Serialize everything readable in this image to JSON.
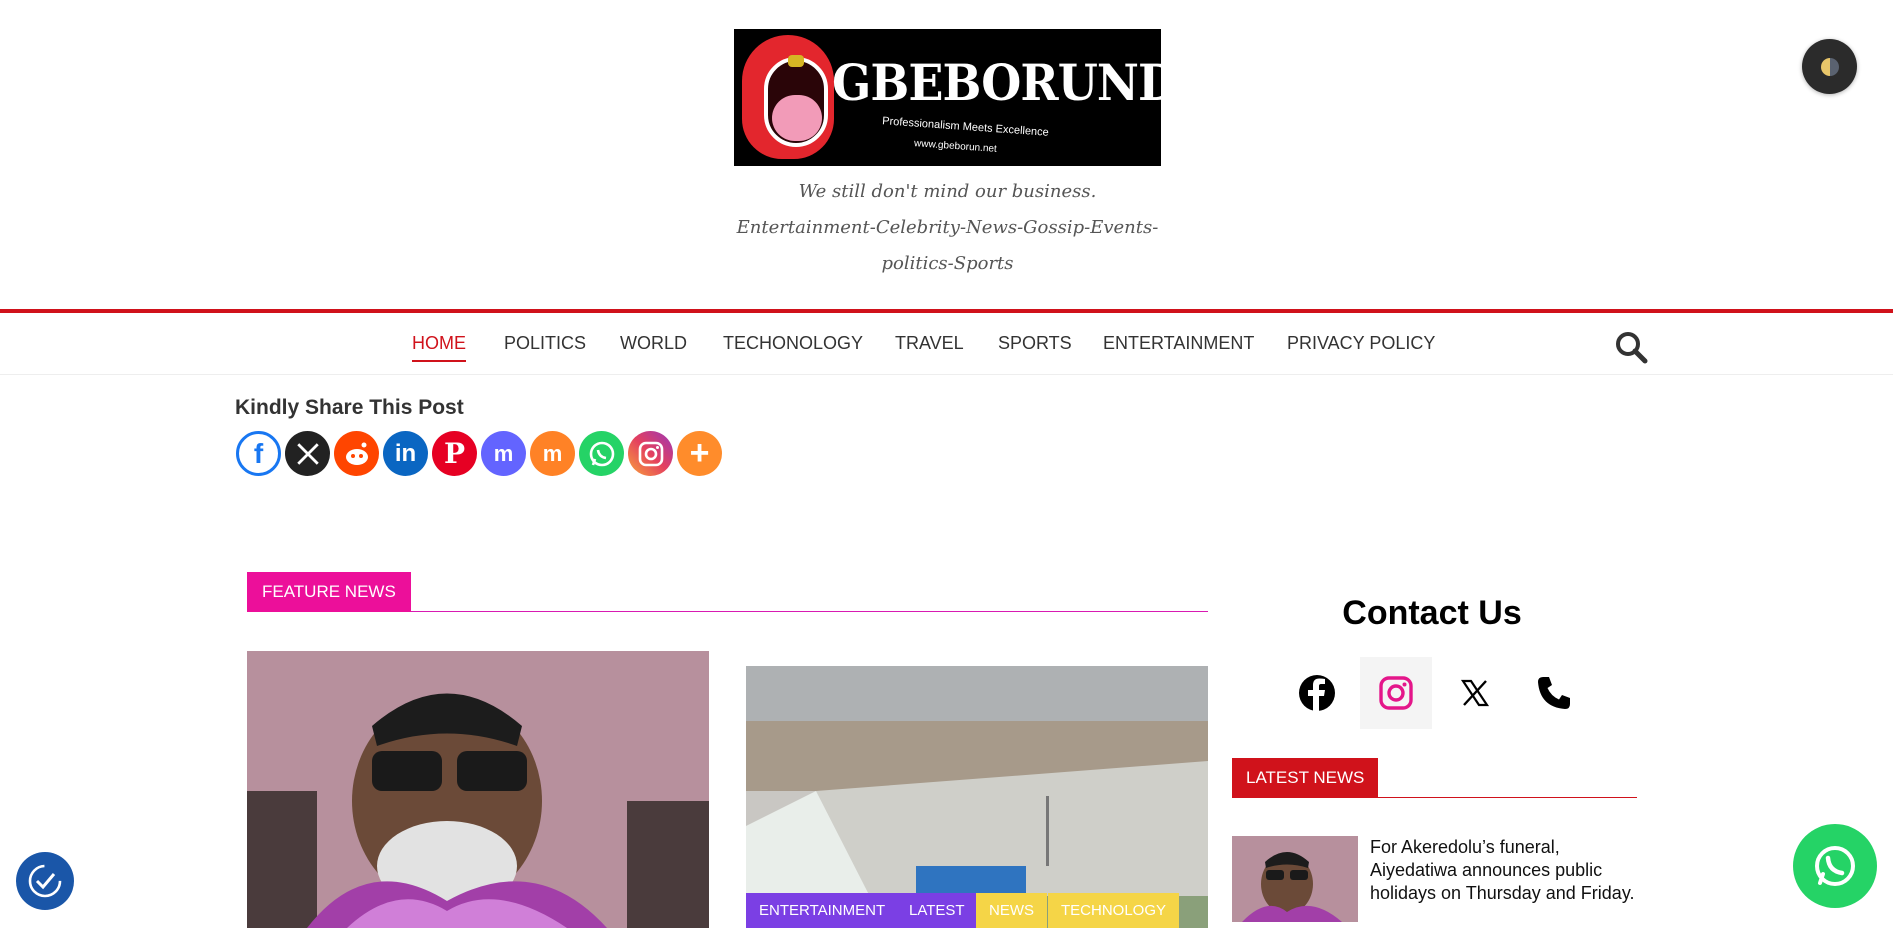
{
  "site": {
    "logo_text": "GBEBORUNDOTCOM",
    "logo_tagline": "Professionalism Meets Excellence",
    "logo_url": "www.gbeborun.net",
    "description_line1": "We still don't mind our business.",
    "description_line2": "Entertainment-Celebrity-News-Gossip-Events-",
    "description_line3": "politics-Sports"
  },
  "nav": {
    "items": [
      {
        "label": "HOME",
        "active": true
      },
      {
        "label": "POLITICS",
        "active": false
      },
      {
        "label": "WORLD",
        "active": false
      },
      {
        "label": "TECHONOLOGY",
        "active": false
      },
      {
        "label": "TRAVEL",
        "active": false
      },
      {
        "label": "SPORTS",
        "active": false
      },
      {
        "label": "ENTERTAINMENT",
        "active": false
      },
      {
        "label": "PRIVACY POLICY",
        "active": false
      }
    ],
    "search_icon": "search-icon"
  },
  "share": {
    "title": "Kindly Share This Post",
    "buttons": [
      {
        "name": "facebook",
        "color": "#1877f2"
      },
      {
        "name": "x",
        "color": "#222222"
      },
      {
        "name": "reddit",
        "color": "#ff4500"
      },
      {
        "name": "linkedin",
        "color": "#0a66c2"
      },
      {
        "name": "pinterest",
        "color": "#e60023"
      },
      {
        "name": "mastodon",
        "color": "#6364ff"
      },
      {
        "name": "mix",
        "color": "#ff8226"
      },
      {
        "name": "whatsapp",
        "color": "#25d366"
      },
      {
        "name": "instagram",
        "color": "#e4405f"
      },
      {
        "name": "more",
        "color": "#ff8c2b"
      }
    ]
  },
  "feature": {
    "heading": "FEATURE NEWS",
    "tags": [
      {
        "label": "ENTERTAINMENT",
        "color": "#7b3fe4"
      },
      {
        "label": "LATEST",
        "color": "#7b3fe4"
      },
      {
        "label": "NEWS",
        "color": "#f5d547"
      },
      {
        "label": "TECHNOLOGY",
        "color": "#f5d547"
      }
    ]
  },
  "sidebar": {
    "contact_title": "Contact Us",
    "contact_icons": [
      "facebook-icon",
      "instagram-icon",
      "x-icon",
      "phone-icon"
    ],
    "latest_heading": "LATEST NEWS",
    "latest_items": [
      {
        "title": "For Akeredolu’s funeral, Aiyedatiwa announces public holidays on Thursday and Friday."
      }
    ]
  },
  "colors": {
    "brand_red": "#d0121b",
    "feature_pink": "#ec0f9a",
    "whatsapp_green": "#25d366"
  }
}
